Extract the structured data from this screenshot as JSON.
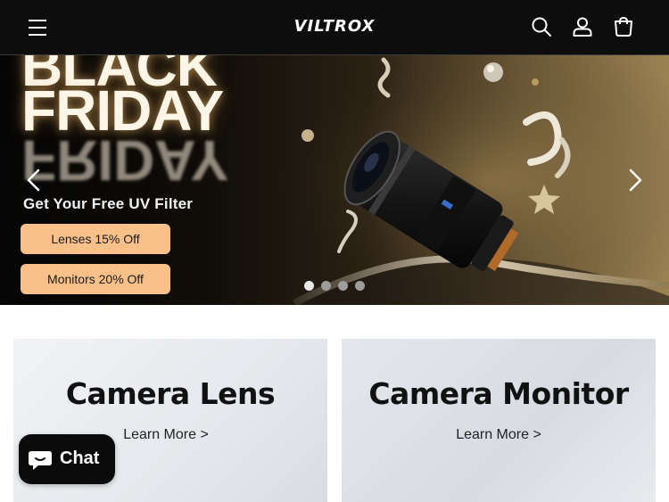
{
  "header": {
    "logo": "VILTROX",
    "icons": [
      "menu-icon",
      "search-icon",
      "account-icon",
      "cart-icon"
    ]
  },
  "hero": {
    "headline_top": "BLACK",
    "headline_main": "FRIDAY",
    "headline_reflection": "FRIDAY",
    "subtitle": "Get Your Free UV Filter",
    "buttons": [
      "Lenses 15% Off",
      "Monitors 20% Off"
    ],
    "slide_count": 4,
    "active_slide": 1
  },
  "categories": [
    {
      "title": "Camera Lens",
      "link": "Learn More >"
    },
    {
      "title": "Camera Monitor",
      "link": "Learn More >"
    }
  ],
  "chat": {
    "label": "Chat"
  },
  "colors": {
    "header_bg": "#0d0d0d",
    "promo_button": "#f9c189",
    "chat_bg": "#0b0b0b"
  }
}
